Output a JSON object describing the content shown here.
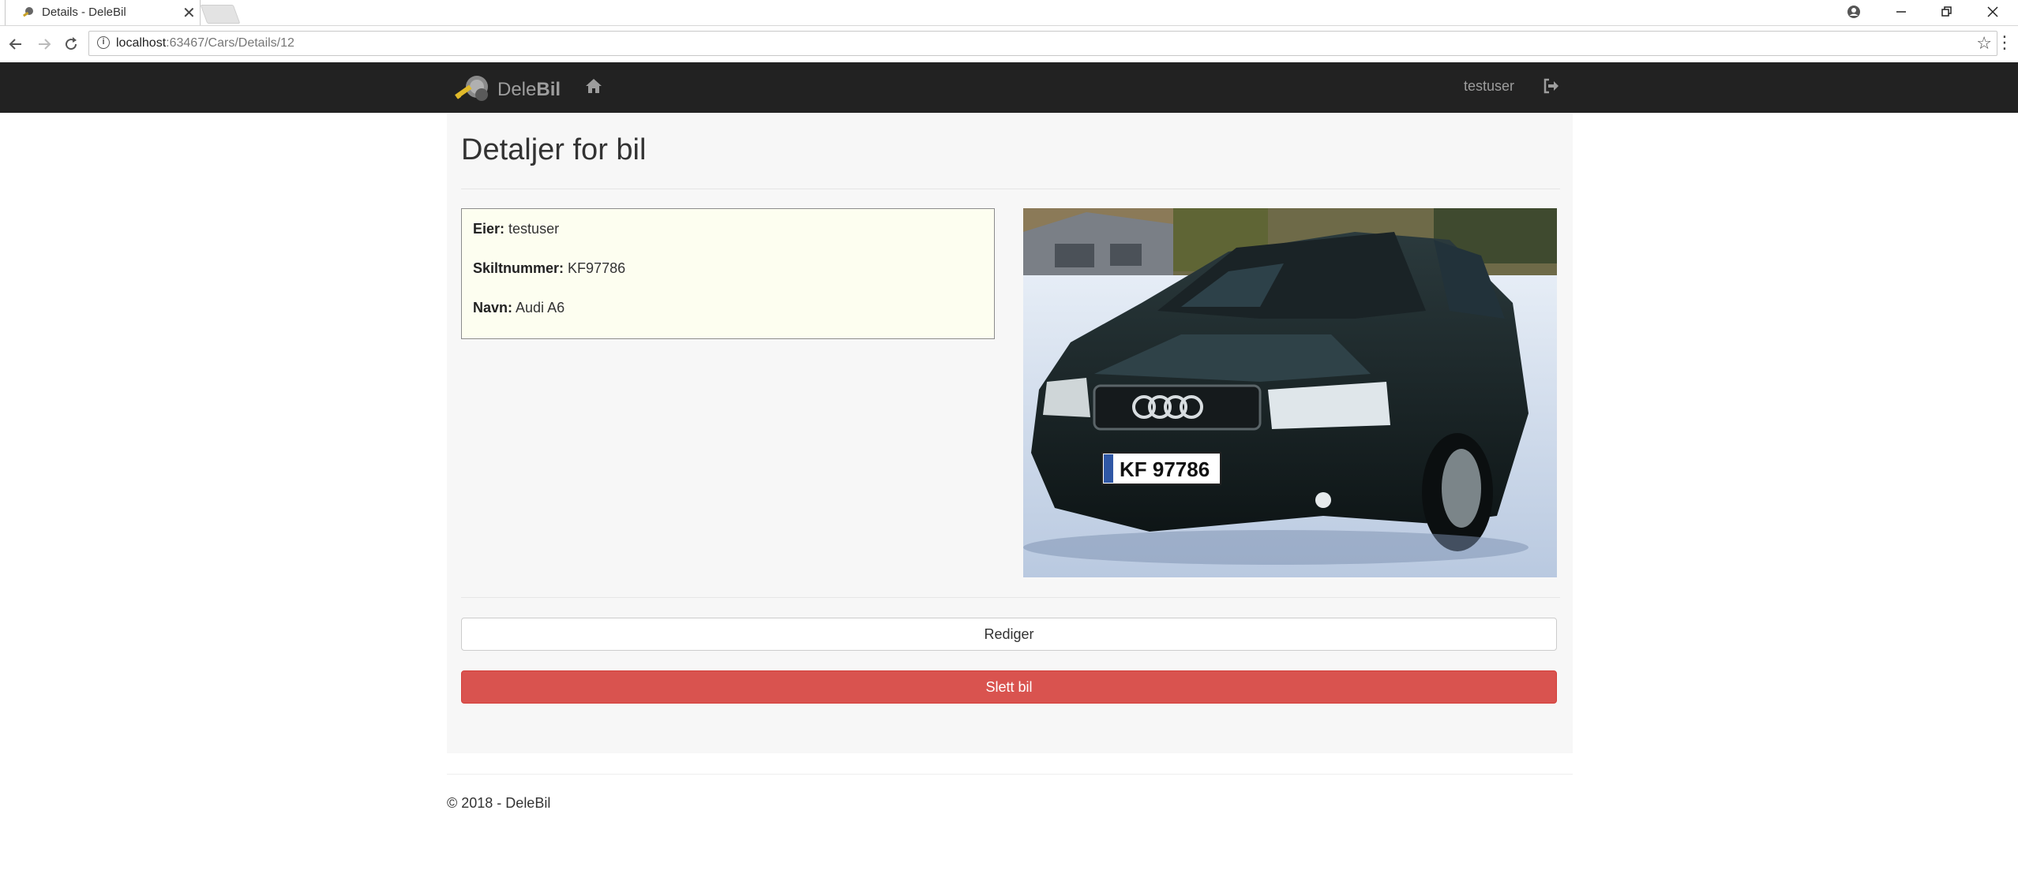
{
  "browser": {
    "tab_title": "Details - DeleBil",
    "tab_close": "✕",
    "url_host": "localhost",
    "url_rest": ":63467/Cars/Details/12",
    "info_glyph": "i"
  },
  "navbar": {
    "brand_light": "Dele",
    "brand_bold": "Bil",
    "username": "testuser"
  },
  "page": {
    "title": "Detaljer for bil"
  },
  "details": {
    "owner_label": "Eier:",
    "owner_value": "testuser",
    "plate_label": "Skiltnummer:",
    "plate_value": "KF97786",
    "name_label": "Navn:",
    "name_value": "Audi A6"
  },
  "photo": {
    "plate_text": "KF 97786"
  },
  "actions": {
    "edit_label": "Rediger",
    "delete_label": "Slett bil"
  },
  "footer": {
    "text": "© 2018 - DeleBil"
  },
  "colors": {
    "navbar_bg": "#222222",
    "delete_bg": "#d9534f",
    "info_box_bg": "#fdfef0",
    "container_bg": "#f7f7f7"
  },
  "icons": {
    "home": "home-icon",
    "logout": "logout-icon",
    "brand_logo": "key-logo-icon"
  }
}
